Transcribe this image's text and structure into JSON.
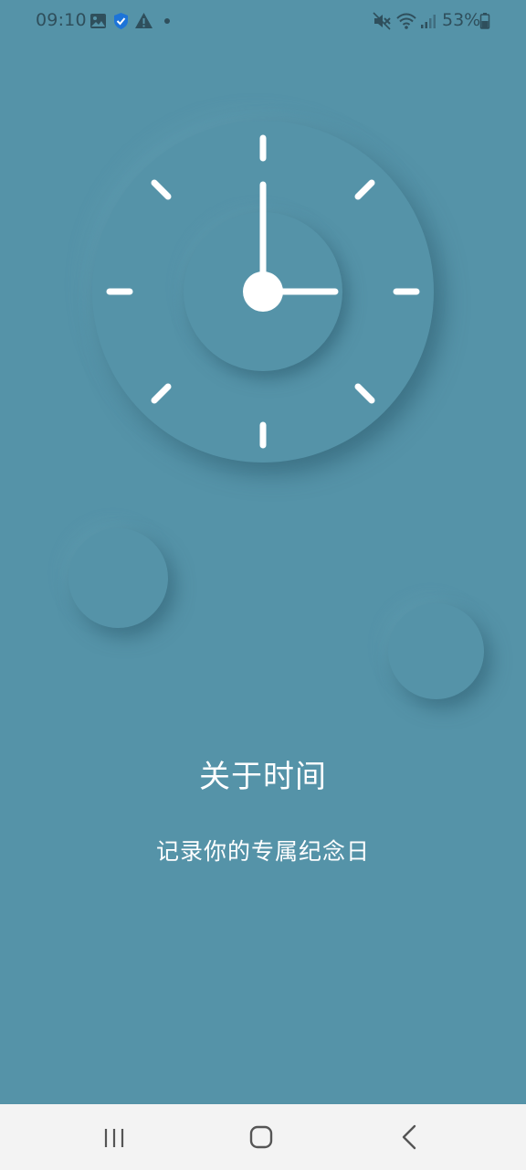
{
  "status_bar": {
    "time": "09:10",
    "battery": "53%",
    "icons": [
      "gallery-icon",
      "shield-check-icon",
      "warning-icon",
      "dot-icon",
      "mute-icon",
      "wifi-icon",
      "signal-icon",
      "battery-icon"
    ]
  },
  "clock": {
    "hour_hand_points_to": 3,
    "minute_hand_points_to": 0,
    "colors": {
      "background": "#5593a8",
      "hands": "#ffffff"
    }
  },
  "content": {
    "title": "关于时间",
    "subtitle": "记录你的专属纪念日"
  },
  "nav_bar": {
    "buttons": [
      "recent-apps",
      "home",
      "back"
    ]
  }
}
